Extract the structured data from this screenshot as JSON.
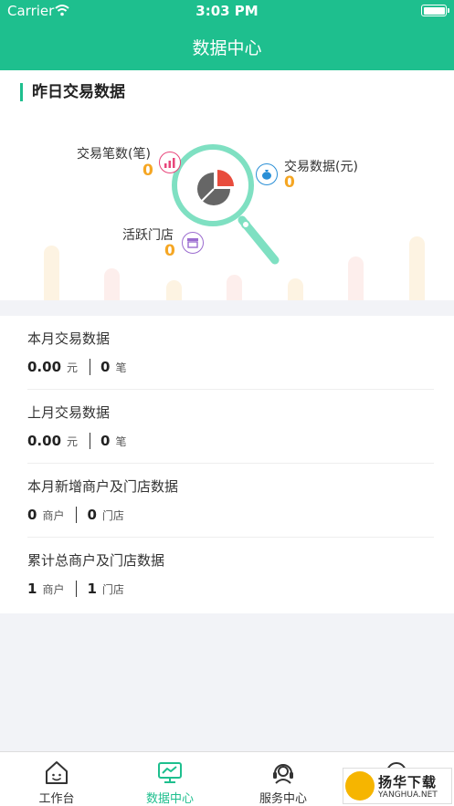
{
  "status_bar": {
    "carrier": "Carrier",
    "time": "3:03 PM"
  },
  "nav": {
    "title": "数据中心"
  },
  "yesterday": {
    "title": "昨日交易数据",
    "transaction_count": {
      "label": "交易笔数(笔)",
      "value": "0",
      "icon": "bar-chart-icon"
    },
    "transaction_amount": {
      "label": "交易数据(元)",
      "value": "0",
      "icon": "money-bag-icon"
    },
    "active_stores": {
      "label": "活跃门店",
      "value": "0",
      "icon": "store-icon"
    },
    "center_icon": "magnifier-pie-chart-icon"
  },
  "stats": [
    {
      "title": "本月交易数据",
      "v1": "0.00",
      "u1": "元",
      "v2": "0",
      "u2": "笔"
    },
    {
      "title": "上月交易数据",
      "v1": "0.00",
      "u1": "元",
      "v2": "0",
      "u2": "笔"
    },
    {
      "title": "本月新增商户及门店数据",
      "v1": "0",
      "u1": "商户",
      "v2": "0",
      "u2": "门店"
    },
    {
      "title": "累计总商户及门店数据",
      "v1": "1",
      "u1": "商户",
      "v2": "1",
      "u2": "门店"
    }
  ],
  "tabs": [
    {
      "label": "工作台",
      "icon": "home-icon"
    },
    {
      "label": "数据中心",
      "icon": "monitor-chart-icon"
    },
    {
      "label": "服务中心",
      "icon": "headset-icon"
    },
    {
      "label": "",
      "icon": "face-icon"
    }
  ],
  "watermark": {
    "name": "扬华下载",
    "url": "YANGHUA.NET"
  },
  "colors": {
    "brand": "#1ebf8e",
    "value": "#f5a623",
    "pink": "#e8457a",
    "blue": "#2a8fd6",
    "purple": "#9b6ccf"
  }
}
